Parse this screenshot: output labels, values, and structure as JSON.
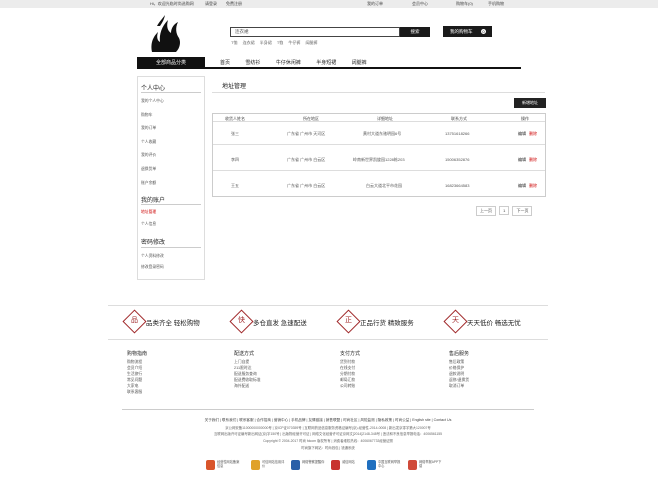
{
  "topbar": {
    "welcome": "Hi，欢迎光临时尚选购网",
    "login": "请登录",
    "register": "免费注册",
    "my_orders": "我的订单",
    "member_center": "会员中心",
    "cart": "购物车(0)",
    "mobile": "手机购物",
    "help": "网站导航"
  },
  "search": {
    "placeholder": "连衣裙",
    "button": "搜索",
    "hotwords": [
      "T恤",
      "连衣裙",
      "半身裙",
      "T恤",
      "牛仔裤",
      "阔腿裤"
    ]
  },
  "cart_button": {
    "label": "我的购物车",
    "count": "0"
  },
  "nav": {
    "category": "全部商品分类",
    "items": [
      "首页",
      "雪纺衫",
      "牛仔休闲裤",
      "半身短裙",
      "阔腿裤"
    ]
  },
  "sidebar": {
    "section1_title": "个人中心",
    "section1_items": [
      "我的个人中心",
      "购物车",
      "我的订单",
      "个人收藏",
      "我的评价",
      "退换货单",
      "账户余额"
    ],
    "section2_title": "我的账户",
    "section2_items": [
      "地址管理",
      "个人信息"
    ],
    "section3_title": "密码修改",
    "section3_items": [
      "个人资料修改",
      "修改登录密码"
    ]
  },
  "main": {
    "title": "地址管理",
    "add_button": "新增地址",
    "headers": [
      "收货人姓名",
      "所在地区",
      "详细地址",
      "联系方式",
      "操作"
    ],
    "rows": [
      {
        "name": "张三",
        "region": "广东省 广州市 天河区",
        "address": "黄村大道东驰明园6号",
        "phone": "13751618266",
        "edit": "编辑",
        "del": "删除"
      },
      {
        "name": "李四",
        "region": "广东省 广州市 白云区",
        "address": "岭南新世界凯旋园1228栋203",
        "phone": "15006352876",
        "edit": "编辑",
        "del": "删除"
      },
      {
        "name": "王五",
        "region": "广东省 广州市 白云区",
        "address": "白云大道北平市花园",
        "phone": "16823664583",
        "edit": "编辑",
        "del": "删除"
      }
    ],
    "pager": {
      "prev": "上一页",
      "current": "1",
      "next": "下一页"
    }
  },
  "promos": [
    {
      "icon": "品",
      "text": "品类齐全 轻松购物"
    },
    {
      "icon": "快",
      "text": "多仓直发 急速配送"
    },
    {
      "icon": "正",
      "text": "正品行货 精致服务"
    },
    {
      "icon": "天",
      "text": "天天低价 畅选无忧"
    }
  ],
  "footer_cols": [
    {
      "title": "购物指南",
      "items": [
        "购物流程",
        "会员介绍",
        "生活旅行",
        "常见问题",
        "大家电",
        "联系客服"
      ]
    },
    {
      "title": "配送方式",
      "items": [
        "上门自提",
        "211限时达",
        "配送服务查询",
        "配送费收取标准",
        "海外配送"
      ]
    },
    {
      "title": "支付方式",
      "items": [
        "货到付款",
        "在线支付",
        "分期付款",
        "邮局汇款",
        "公司转账"
      ]
    },
    {
      "title": "售后服务",
      "items": [
        "售后政策",
        "价格保护",
        "退款说明",
        "返修/退换货",
        "取消订单"
      ]
    }
  ],
  "footer": {
    "links": "关于我们 | 联系我们 | 联系客服 | 合作招商 | 营销中心 | 手机品牌 | 友情链接 | 销售联盟 | 时尚社区 | 风险监测 | 隐私政策 | 时尚公益 | English site | Contact Us",
    "line1": "京公网安备11000000000000号 | 京ICP证070359号 | 互联网药品信息服务资格证编号(京)-经营性-2014-0008 | 新出发京零字第大120007号",
    "line2": "互联网出版许可证编号新出网证(京)字150号 | 出版物经营许可证 | 网络文化经营许可证京网文[2014]2148-348号 | 违法和不良信息举报电话：4006561155",
    "line3": "Copyright © 2004-2017 时尚 fdcom 版权所有 | 消费者维权热线：4006067733经营证照",
    "line4": "时尚旗下网站：时尚钱包 | 钱通系统",
    "badges": [
      "经营性网站备案信息",
      "可信网站信用评价",
      "网络警察提醒你",
      "诚信网站",
      "中国互联网举报中心",
      "网络举报APP下载"
    ]
  },
  "colors": {
    "accent": "#a0282a",
    "dark": "#1a1a1a",
    "link_red": "#cc0000"
  }
}
